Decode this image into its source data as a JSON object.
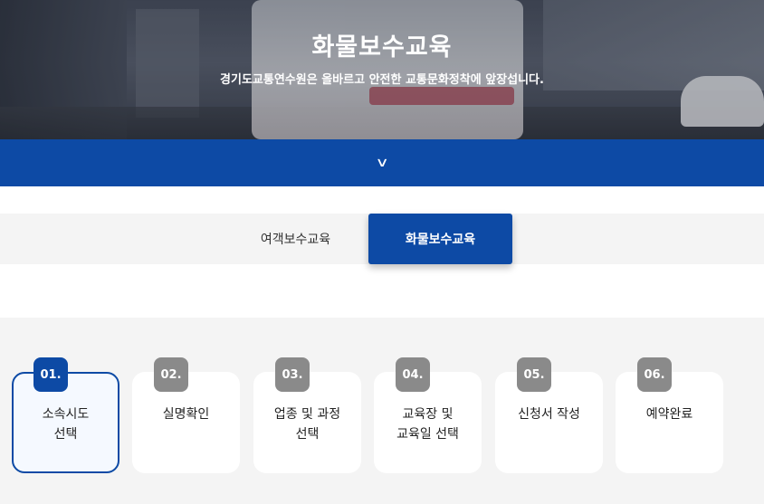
{
  "hero": {
    "title": "화물보수교육",
    "subtitle": "경기도교통연수원은 올바르고 안전한 교통문화정착에 앞장섭니다."
  },
  "banner": {
    "toggle_icon": "chevron-down-icon",
    "color": "#0d4aa5"
  },
  "tabs": [
    {
      "label": "여객보수교육",
      "active": false
    },
    {
      "label": "화물보수교육",
      "active": true
    }
  ],
  "steps": [
    {
      "number": "01.",
      "label": "소속시도\n선택",
      "selected": true
    },
    {
      "number": "02.",
      "label": "실명확인",
      "selected": false
    },
    {
      "number": "03.",
      "label": "업종 및 과정\n선택",
      "selected": false
    },
    {
      "number": "04.",
      "label": "교육장 및\n교육일 선택",
      "selected": false
    },
    {
      "number": "05.",
      "label": "신청서 작성",
      "selected": false
    },
    {
      "number": "06.",
      "label": "예약완료",
      "selected": false
    }
  ]
}
